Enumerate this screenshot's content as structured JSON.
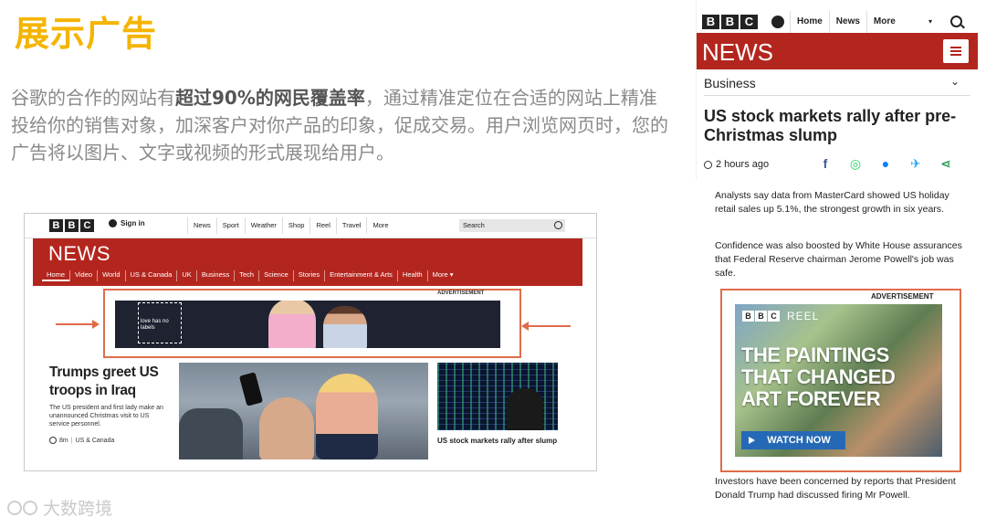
{
  "slide": {
    "title": "展示广告",
    "text_prefix": "谷歌的合作的网站有",
    "text_bold": "超过90%的网民覆盖率",
    "text_rest": "，通过精准定位在合适的网站上精准投给你的销售对象，加深客户对你产品的印象，促成交易。用户浏览网页时，您的广告将以图片、文字或视频的形式展现给用户。"
  },
  "desktop": {
    "logo": [
      "B",
      "B",
      "C"
    ],
    "signin": "Sign in",
    "topnav": [
      "News",
      "Sport",
      "Weather",
      "Shop",
      "Reel",
      "Travel",
      "More"
    ],
    "search_placeholder": "Search",
    "brand": "NEWS",
    "subnav": [
      "Home",
      "Video",
      "World",
      "US & Canada",
      "UK",
      "Business",
      "Tech",
      "Science",
      "Stories",
      "Entertainment & Arts",
      "Health",
      "More ▾"
    ],
    "ad_label": "ADVERTISEMENT",
    "banner_text": "love has no labels",
    "headline": "Trumps greet US troops in Iraq",
    "summary": "The US president and first lady make an unannounced Christmas visit to US service personnel.",
    "meta_time": "8m",
    "meta_section": "US & Canada",
    "secondary_caption": "US stock markets rally after slump"
  },
  "mobile": {
    "logo": [
      "B",
      "B",
      "C"
    ],
    "nav": [
      "Home",
      "News",
      "More"
    ],
    "brand": "NEWS",
    "section": "Business",
    "title": "US stock markets rally after pre-Christmas slump",
    "time": "2 hours ago",
    "share_icons": [
      "facebook-icon",
      "whatsapp-icon",
      "messenger-icon",
      "twitter-icon",
      "share-icon"
    ],
    "para1": "Analysts say data from MasterCard showed US holiday retail sales up 5.1%, the strongest growth in six years.",
    "para2": "Confidence was also boosted by White House assurances that Federal Reserve chairman Jerome Powell's job was safe.",
    "ad_label": "ADVERTISEMENT",
    "ad_brand": "REEL",
    "ad_headline": "THE PAINTINGS THAT CHANGED ART FOREVER",
    "ad_button": "WATCH NOW",
    "para3": "Investors have been concerned by reports that President Donald Trump had discussed firing Mr Powell."
  },
  "watermark": "大数跨境",
  "colors": {
    "accent_orange": "#f5b400",
    "bbc_red": "#b3261e",
    "highlight": "#e06c4a",
    "ad_blue": "#2569b6"
  }
}
